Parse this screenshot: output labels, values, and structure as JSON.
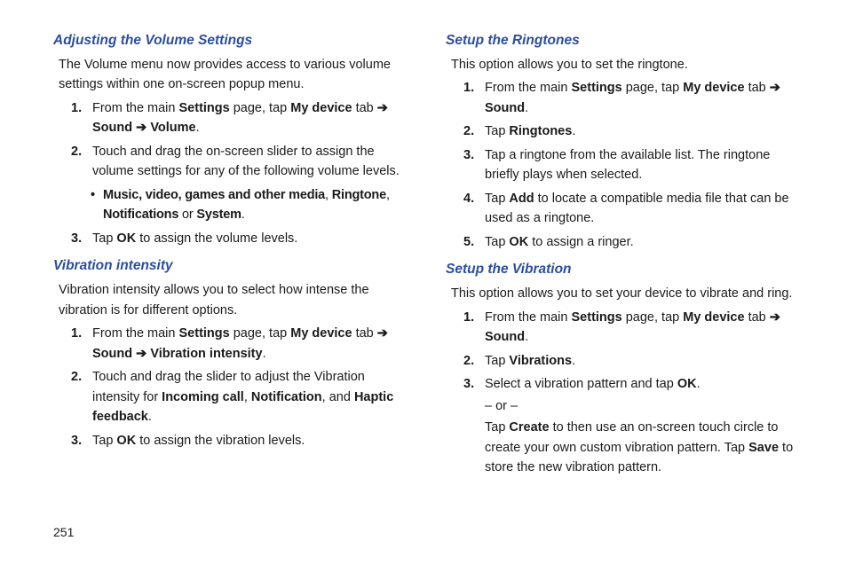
{
  "page_number": "251",
  "left_column": {
    "section1": {
      "heading": "Adjusting the Volume Settings",
      "intro": "The Volume menu now provides access to various volume settings within one on-screen popup menu.",
      "steps": [
        {
          "n": "1.",
          "pre": "From the main ",
          "b1": "Settings",
          "mid1": " page, tap ",
          "b2": "My device",
          "mid2": " tab ",
          "arrow": "➔",
          "b3": "Sound",
          "mid3": " ",
          "arrow2": "➔",
          "mid4": " ",
          "b4": "Volume",
          "end": "."
        },
        {
          "n": "2.",
          "text": "Touch and drag the on-screen slider to assign the volume settings for any of the following volume levels.",
          "bullet": {
            "b1": "Music, video, games and other media",
            "sep1": ", ",
            "b2": "Ringtone",
            "sep2": ", ",
            "b3": "Notifications",
            "or": " or ",
            "b4": "System",
            "end": "."
          }
        },
        {
          "n": "3.",
          "pre": "Tap ",
          "b1": "OK",
          "end": " to assign the volume levels."
        }
      ]
    },
    "section2": {
      "heading": "Vibration intensity",
      "intro": "Vibration intensity allows you to select how intense the vibration is for different options.",
      "steps": [
        {
          "n": "1.",
          "pre": "From the main ",
          "b1": "Settings",
          "mid1": " page, tap ",
          "b2": "My device",
          "mid2": " tab ",
          "arrow": "➔",
          "b3": "Sound",
          "mid3": " ",
          "arrow2": "➔",
          "mid4": " ",
          "b4": "Vibration intensity",
          "end": "."
        },
        {
          "n": "2.",
          "pre": "Touch and drag the slider to adjust the Vibration intensity for ",
          "b1": "Incoming call",
          "sep1": ", ",
          "b2": "Notification",
          "sep2": ", and ",
          "b3": "Haptic feedback",
          "end": "."
        },
        {
          "n": "3.",
          "pre": "Tap ",
          "b1": "OK",
          "end": " to assign the vibration levels."
        }
      ]
    }
  },
  "right_column": {
    "section1": {
      "heading": "Setup the Ringtones",
      "intro": "This option allows you to set the ringtone.",
      "steps": [
        {
          "n": "1.",
          "pre": "From the main ",
          "b1": "Settings",
          "mid1": " page, tap ",
          "b2": "My device",
          "mid2": " tab ",
          "arrow": "➔",
          "b3": "Sound",
          "end": "."
        },
        {
          "n": "2.",
          "pre": "Tap ",
          "b1": "Ringtones",
          "end": "."
        },
        {
          "n": "3.",
          "text": "Tap a ringtone from the available list. The ringtone briefly plays when selected."
        },
        {
          "n": "4.",
          "pre": "Tap ",
          "b1": "Add",
          "end": " to locate a compatible media file that can be used as a ringtone."
        },
        {
          "n": "5.",
          "pre": "Tap ",
          "b1": "OK",
          "end": " to assign a ringer."
        }
      ]
    },
    "section2": {
      "heading": "Setup the Vibration",
      "intro": "This option allows you to set your device to vibrate and ring.",
      "steps": [
        {
          "n": "1.",
          "pre": "From the main ",
          "b1": "Settings",
          "mid1": " page, tap ",
          "b2": "My device",
          "mid2": " tab ",
          "arrow": "➔",
          "b3": "Sound",
          "end": "."
        },
        {
          "n": "2.",
          "pre": "Tap ",
          "b1": "Vibrations",
          "end": "."
        },
        {
          "n": "3.",
          "pre": "Select a vibration pattern and tap ",
          "b1": "OK",
          "end": ".",
          "or": "– or –",
          "extra_pre": "Tap ",
          "extra_b1": "Create",
          "extra_mid1": " to then use an on-screen touch circle to create your own custom vibration pattern. Tap ",
          "extra_b2": "Save",
          "extra_end": " to store the new vibration pattern."
        }
      ]
    }
  }
}
